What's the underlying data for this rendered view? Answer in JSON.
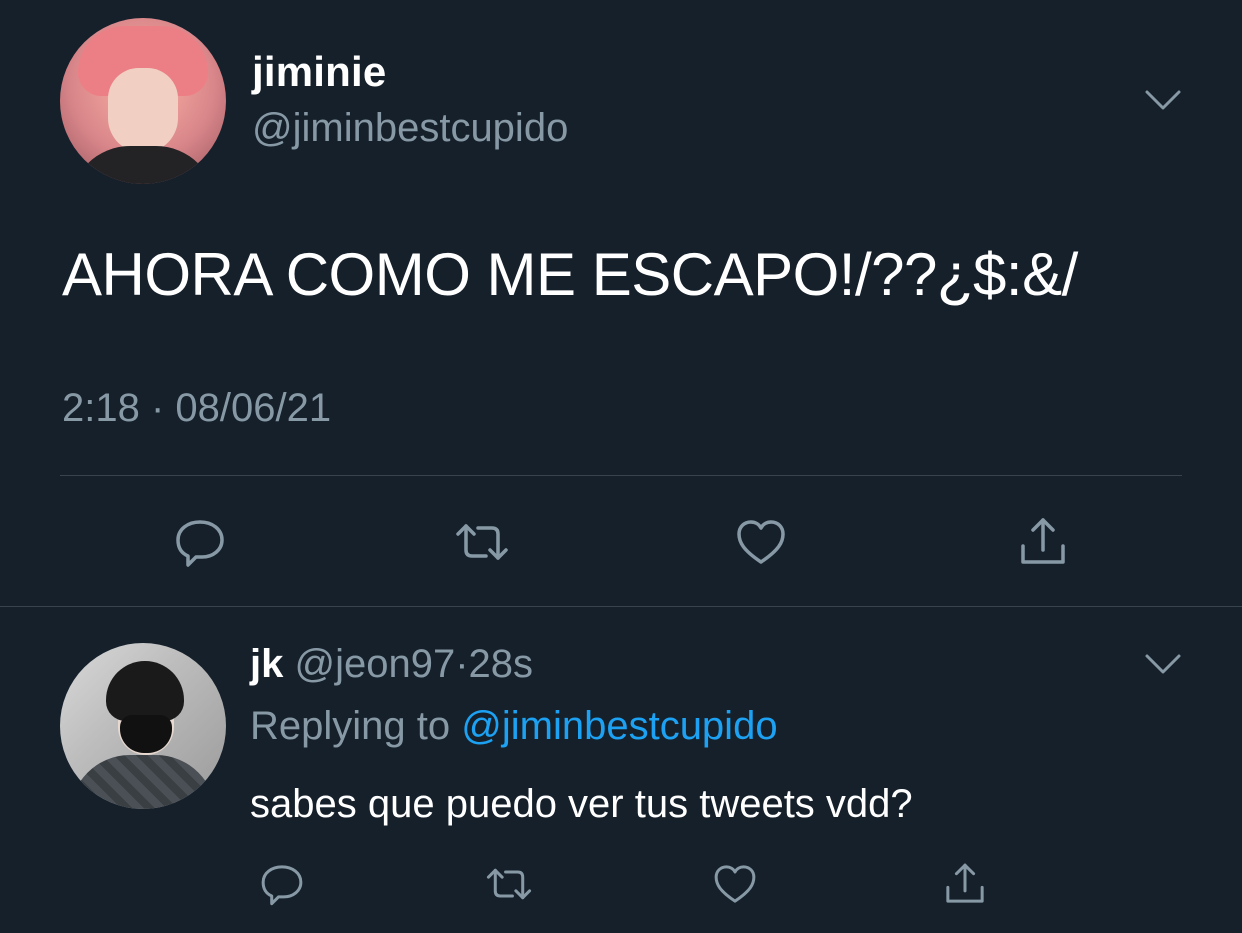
{
  "main_tweet": {
    "display_name": "jiminie",
    "handle": "@jiminbestcupido",
    "text": "AHORA COMO ME ESCAPO!/??¿$:&/",
    "timestamp": "2:18 · 08/06/21",
    "actions": [
      "reply-icon",
      "retweet-icon",
      "like-icon",
      "share-icon"
    ],
    "menu_icon": "chevron-down-icon"
  },
  "reply_tweet": {
    "display_name": "jk",
    "handle": "@jeon97",
    "separator": "·",
    "time": "28s",
    "replying_prefix": "Replying to",
    "replying_to": "@jiminbestcupido",
    "text": "sabes que puedo ver tus tweets vdd?",
    "actions": [
      "reply-icon",
      "retweet-icon",
      "like-icon",
      "share-icon"
    ],
    "menu_icon": "chevron-down-icon"
  },
  "colors": {
    "background": "#15202b",
    "primary_text": "#ffffff",
    "secondary_text": "#8899a6",
    "link": "#1da1f2",
    "divider": "#38444d"
  }
}
